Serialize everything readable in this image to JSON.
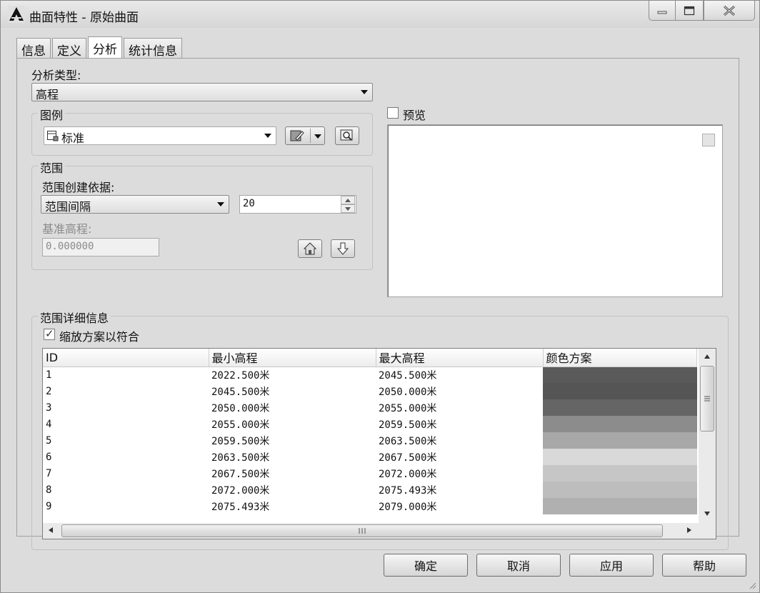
{
  "window": {
    "title": "曲面特性 - 原始曲面"
  },
  "tabs": [
    {
      "label": "信息"
    },
    {
      "label": "定义"
    },
    {
      "label": "分析"
    },
    {
      "label": "统计信息"
    }
  ],
  "analysis": {
    "type_label": "分析类型:",
    "type_value": "高程",
    "legend_group": "图例",
    "legend_value": "标准",
    "range_group": "范围",
    "range_by_label": "范围创建依据:",
    "range_by_value": "范围间隔",
    "range_interval_value": "20",
    "base_elev_label": "基准高程:",
    "base_elev_value": "0.000000",
    "preview_label": "预览",
    "preview_checked": false
  },
  "details": {
    "group_title": "范围详细信息",
    "fit_label": "缩放方案以符合",
    "fit_checked": true,
    "columns": [
      "ID",
      "最小高程",
      "最大高程",
      "颜色方案"
    ],
    "rows": [
      {
        "id": "1",
        "min": "2022.500米",
        "max": "2045.500米",
        "color": "#5a5a5a"
      },
      {
        "id": "2",
        "min": "2045.500米",
        "max": "2050.000米",
        "color": "#555555"
      },
      {
        "id": "3",
        "min": "2050.000米",
        "max": "2055.000米",
        "color": "#656565"
      },
      {
        "id": "4",
        "min": "2055.000米",
        "max": "2059.500米",
        "color": "#8c8c8c"
      },
      {
        "id": "5",
        "min": "2059.500米",
        "max": "2063.500米",
        "color": "#a8a8a8"
      },
      {
        "id": "6",
        "min": "2063.500米",
        "max": "2067.500米",
        "color": "#d9d9d9"
      },
      {
        "id": "7",
        "min": "2067.500米",
        "max": "2072.000米",
        "color": "#c6c6c6"
      },
      {
        "id": "8",
        "min": "2072.000米",
        "max": "2075.493米",
        "color": "#bdbdbd"
      },
      {
        "id": "9",
        "min": "2075.493米",
        "max": "2079.000米",
        "color": "#b0b0b0"
      }
    ]
  },
  "buttons": {
    "ok": "确定",
    "cancel": "取消",
    "apply": "应用",
    "help": "帮助"
  }
}
